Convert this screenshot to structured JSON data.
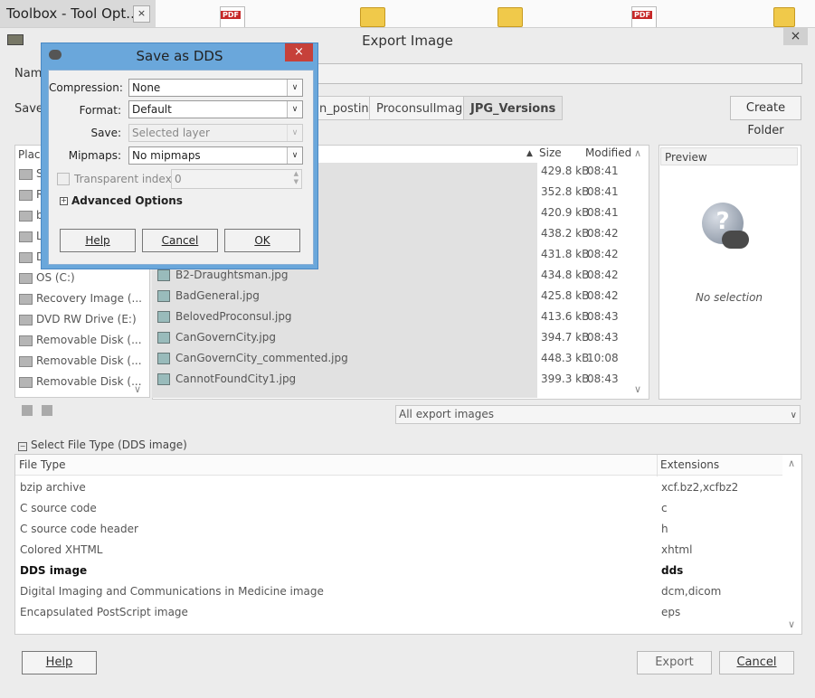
{
  "taskbar": {
    "title": "Toolbox - Tool Opt...",
    "close": "×",
    "pdf_label": "PDF"
  },
  "export": {
    "title": "Export Image",
    "close": "×",
    "name_label": "Name",
    "save_in_label": "Save i",
    "path_buttons": [
      "n_posting",
      "ProconsulImages",
      "JPG_Versions"
    ],
    "create_folder": "Create Folder",
    "places_header": "Place",
    "places": [
      "S",
      "R",
      "b",
      "L",
      "D",
      "OS (C:)",
      "Recovery Image (...",
      "DVD RW Drive (E:)",
      "Removable Disk (...",
      "Removable Disk (...",
      "Removable Disk (..."
    ],
    "columns": {
      "size": "Size",
      "modified": "Modified"
    },
    "files": [
      {
        "name": "",
        "size": "429.8 kB",
        "modified": "08:41"
      },
      {
        "name": "",
        "size": "352.8 kB",
        "modified": "08:41"
      },
      {
        "name": "",
        "size": "420.9 kB",
        "modified": "08:41"
      },
      {
        "name": "",
        "size": "438.2 kB",
        "modified": "08:42"
      },
      {
        "name": "",
        "size": "431.8 kB",
        "modified": "08:42"
      },
      {
        "name": "B2-Draughtsman.jpg",
        "size": "434.8 kB",
        "modified": "08:42"
      },
      {
        "name": "BadGeneral.jpg",
        "size": "425.8 kB",
        "modified": "08:42"
      },
      {
        "name": "BelovedProconsul.jpg",
        "size": "413.6 kB",
        "modified": "08:43"
      },
      {
        "name": "CanGovernCity.jpg",
        "size": "394.7 kB",
        "modified": "08:43"
      },
      {
        "name": "CanGovernCity_commented.jpg",
        "size": "448.3 kB",
        "modified": "10:08"
      },
      {
        "name": "CannotFoundCity1.jpg",
        "size": "399.3 kB",
        "modified": "08:43"
      }
    ],
    "preview_header": "Preview",
    "preview_text": "No selection",
    "filter": "All export images",
    "file_type_toggle": "Select File Type (DDS image)",
    "file_type_columns": {
      "type": "File Type",
      "ext": "Extensions"
    },
    "file_types": [
      {
        "type": "bzip archive",
        "ext": "xcf.bz2,xcfbz2"
      },
      {
        "type": "C source code",
        "ext": "c"
      },
      {
        "type": "C source code header",
        "ext": "h"
      },
      {
        "type": "Colored XHTML",
        "ext": "xhtml"
      },
      {
        "type": "DDS image",
        "ext": "dds"
      },
      {
        "type": "Digital Imaging and Communications in Medicine image",
        "ext": "dcm,dicom"
      },
      {
        "type": "Encapsulated PostScript image",
        "ext": "eps"
      }
    ],
    "help": "Help",
    "export_btn": "Export",
    "cancel": "Cancel"
  },
  "dds": {
    "title": "Save as DDS",
    "close": "×",
    "compression_label": "Compression:",
    "compression_value": "None",
    "format_label": "Format:",
    "format_value": "Default",
    "save_label": "Save:",
    "save_value": "Selected layer",
    "mipmaps_label": "Mipmaps:",
    "mipmaps_value": "No mipmaps",
    "transparent_label": "Transparent index:",
    "transparent_value": "0",
    "advanced_expander": "+",
    "advanced": "Advanced Options",
    "help": "Help",
    "cancel": "Cancel",
    "ok": "OK"
  },
  "colors": {
    "accent": "#6aa7db",
    "close_red": "#c6413a"
  }
}
